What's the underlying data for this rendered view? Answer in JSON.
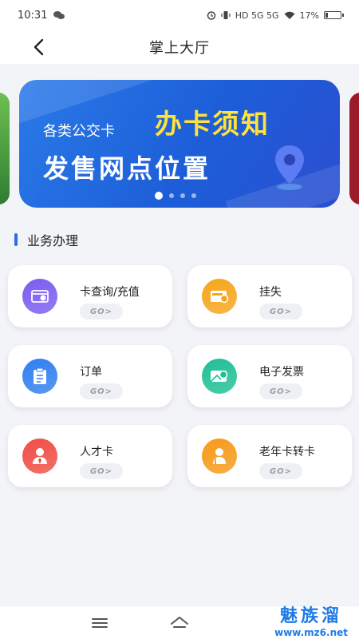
{
  "status": {
    "time": "10:31",
    "network": "HD 5G 5G",
    "battery": "17%",
    "battery_level": 0.17
  },
  "header": {
    "title": "掌上大厅"
  },
  "banner": {
    "small_text": "各类公交卡",
    "big_text": "办卡须知",
    "sub_text": "发售网点位置",
    "slide_count": 4,
    "active_slide": 0
  },
  "section": {
    "title": "业务办理"
  },
  "services": [
    {
      "label": "卡查询/充值",
      "go": "GO>",
      "icon": "card-yen-icon",
      "color": "#7b5cf0"
    },
    {
      "label": "挂失",
      "go": "GO>",
      "icon": "wallet-lock-icon",
      "color": "#f5a51a"
    },
    {
      "label": "订单",
      "go": "GO>",
      "icon": "clipboard-icon",
      "color": "#2f7ef0"
    },
    {
      "label": "电子发票",
      "go": "GO>",
      "icon": "invoice-yen-icon",
      "color": "#1fbf95"
    },
    {
      "label": "人才卡",
      "go": "GO>",
      "icon": "person-card-icon",
      "color": "#ef4d45"
    },
    {
      "label": "老年卡转卡",
      "go": "GO>",
      "icon": "elder-icon",
      "color": "#f59a18"
    }
  ],
  "watermark": {
    "name": "魅族溜",
    "url": "www.mz6.net"
  }
}
